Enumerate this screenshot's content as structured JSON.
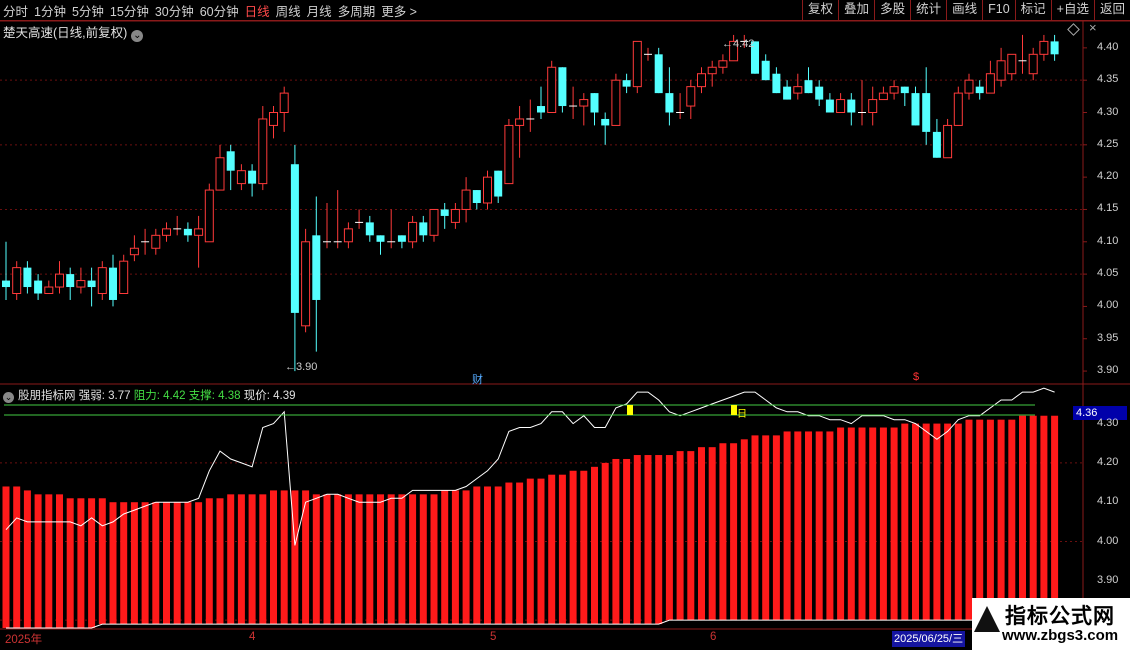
{
  "toolbar": {
    "periods": [
      {
        "label": "分时",
        "active": false
      },
      {
        "label": "1分钟",
        "active": false
      },
      {
        "label": "5分钟",
        "active": false
      },
      {
        "label": "15分钟",
        "active": false
      },
      {
        "label": "30分钟",
        "active": false
      },
      {
        "label": "60分钟",
        "active": false
      },
      {
        "label": "日线",
        "active": true
      },
      {
        "label": "周线",
        "active": false
      },
      {
        "label": "月线",
        "active": false
      },
      {
        "label": "多周期",
        "active": false
      },
      {
        "label": "更多 >",
        "active": false
      }
    ],
    "right_buttons": [
      "复权",
      "叠加",
      "多股",
      "统计",
      "画线",
      "F10",
      "标记",
      "+自选",
      "返回"
    ]
  },
  "main_panel": {
    "title": "楚天高速(日线,前复权)",
    "high_label": "4.42",
    "low_label": "3.90",
    "event_cai": "财",
    "event_s": "$",
    "price_axis": [
      "4.40",
      "4.35",
      "4.30",
      "4.25",
      "4.20",
      "4.15",
      "4.10",
      "4.05",
      "4.00",
      "3.95",
      "3.90"
    ]
  },
  "indicator_panel": {
    "name": "股朋指标网",
    "strength_label": "强弱:",
    "strength_value": "3.77",
    "resistance_label": "阻力:",
    "resistance_value": "4.42",
    "support_label": "支撑:",
    "support_value": "4.38",
    "price_label": "现价:",
    "price_value": "4.39",
    "current_value_box": "4.36",
    "axis": [
      "4.30",
      "4.20",
      "4.10",
      "4.00",
      "3.90",
      "3.80"
    ],
    "mark_sell": "卖",
    "mark_day": "日"
  },
  "date_axis": {
    "labels": [
      "2025年",
      "4",
      "5",
      "6"
    ],
    "cursor_date": "2025/06/25/三"
  },
  "watermark": {
    "line1": "指标公式网",
    "line2": "www.zbgs3.com"
  },
  "colors": {
    "up": "#ff3a3a",
    "down": "#54ffff",
    "grid": "#6a0f0f",
    "line": "#ffffff",
    "level_line": "#44cc44",
    "marker": "#ffff00"
  },
  "chart_data": {
    "type": "candlestick",
    "ylim": [
      3.88,
      4.44
    ],
    "candles": [
      [
        4.04,
        4.03,
        4.1,
        4.01
      ],
      [
        4.02,
        4.06,
        4.07,
        4.01
      ],
      [
        4.06,
        4.03,
        4.07,
        4.02
      ],
      [
        4.04,
        4.02,
        4.05,
        4.01
      ],
      [
        4.02,
        4.03,
        4.04,
        4.02
      ],
      [
        4.03,
        4.05,
        4.07,
        4.02
      ],
      [
        4.05,
        4.03,
        4.06,
        4.01
      ],
      [
        4.03,
        4.04,
        4.06,
        4.02
      ],
      [
        4.04,
        4.03,
        4.06,
        4.0
      ],
      [
        4.02,
        4.06,
        4.07,
        4.01
      ],
      [
        4.06,
        4.01,
        4.08,
        4.0
      ],
      [
        4.02,
        4.07,
        4.08,
        4.02
      ],
      [
        4.08,
        4.09,
        4.11,
        4.07
      ],
      [
        4.1,
        4.1,
        4.12,
        4.08
      ],
      [
        4.09,
        4.11,
        4.12,
        4.08
      ],
      [
        4.11,
        4.12,
        4.13,
        4.1
      ],
      [
        4.12,
        4.12,
        4.14,
        4.11
      ],
      [
        4.12,
        4.11,
        4.13,
        4.1
      ],
      [
        4.11,
        4.12,
        4.14,
        4.06
      ],
      [
        4.1,
        4.18,
        4.19,
        4.1
      ],
      [
        4.18,
        4.23,
        4.25,
        4.18
      ],
      [
        4.24,
        4.21,
        4.25,
        4.18
      ],
      [
        4.19,
        4.21,
        4.22,
        4.18
      ],
      [
        4.21,
        4.19,
        4.22,
        4.17
      ],
      [
        4.19,
        4.29,
        4.31,
        4.18
      ],
      [
        4.28,
        4.3,
        4.31,
        4.26
      ],
      [
        4.3,
        4.33,
        4.34,
        4.27
      ],
      [
        4.22,
        3.99,
        4.25,
        3.9
      ],
      [
        3.97,
        4.1,
        4.12,
        3.96
      ],
      [
        4.11,
        4.01,
        4.17,
        3.93
      ],
      [
        4.1,
        4.1,
        4.16,
        4.09
      ],
      [
        4.1,
        4.1,
        4.18,
        4.09
      ],
      [
        4.1,
        4.12,
        4.13,
        4.09
      ],
      [
        4.13,
        4.13,
        4.15,
        4.12
      ],
      [
        4.13,
        4.11,
        4.14,
        4.1
      ],
      [
        4.11,
        4.1,
        4.11,
        4.08
      ],
      [
        4.1,
        4.1,
        4.15,
        4.09
      ],
      [
        4.11,
        4.1,
        4.11,
        4.09
      ],
      [
        4.1,
        4.13,
        4.14,
        4.09
      ],
      [
        4.13,
        4.11,
        4.14,
        4.1
      ],
      [
        4.11,
        4.15,
        4.15,
        4.1
      ],
      [
        4.15,
        4.14,
        4.16,
        4.12
      ],
      [
        4.13,
        4.15,
        4.16,
        4.12
      ],
      [
        4.15,
        4.18,
        4.2,
        4.13
      ],
      [
        4.18,
        4.16,
        4.18,
        4.15
      ],
      [
        4.16,
        4.2,
        4.21,
        4.15
      ],
      [
        4.21,
        4.17,
        4.21,
        4.16
      ],
      [
        4.19,
        4.28,
        4.29,
        4.19
      ],
      [
        4.28,
        4.29,
        4.31,
        4.23
      ],
      [
        4.29,
        4.29,
        4.32,
        4.27
      ],
      [
        4.31,
        4.3,
        4.34,
        4.29
      ],
      [
        4.3,
        4.37,
        4.38,
        4.3
      ],
      [
        4.37,
        4.31,
        4.37,
        4.3
      ],
      [
        4.31,
        4.31,
        4.34,
        4.29
      ],
      [
        4.31,
        4.32,
        4.33,
        4.28
      ],
      [
        4.33,
        4.3,
        4.33,
        4.28
      ],
      [
        4.29,
        4.28,
        4.3,
        4.25
      ],
      [
        4.28,
        4.35,
        4.36,
        4.28
      ],
      [
        4.35,
        4.34,
        4.36,
        4.33
      ],
      [
        4.34,
        4.41,
        4.41,
        4.33
      ],
      [
        4.39,
        4.39,
        4.4,
        4.38
      ],
      [
        4.39,
        4.33,
        4.4,
        4.33
      ],
      [
        4.33,
        4.3,
        4.37,
        4.28
      ],
      [
        4.3,
        4.3,
        4.33,
        4.29
      ],
      [
        4.31,
        4.34,
        4.35,
        4.29
      ],
      [
        4.34,
        4.36,
        4.37,
        4.33
      ],
      [
        4.36,
        4.37,
        4.38,
        4.34
      ],
      [
        4.37,
        4.38,
        4.39,
        4.36
      ],
      [
        4.38,
        4.41,
        4.42,
        4.38
      ],
      [
        4.41,
        4.41,
        4.42,
        4.4
      ],
      [
        4.41,
        4.36,
        4.41,
        4.36
      ],
      [
        4.38,
        4.35,
        4.39,
        4.35
      ],
      [
        4.36,
        4.33,
        4.37,
        4.33
      ],
      [
        4.34,
        4.32,
        4.35,
        4.32
      ],
      [
        4.33,
        4.34,
        4.36,
        4.32
      ],
      [
        4.35,
        4.33,
        4.37,
        4.33
      ],
      [
        4.34,
        4.32,
        4.35,
        4.31
      ],
      [
        4.32,
        4.3,
        4.33,
        4.3
      ],
      [
        4.3,
        4.32,
        4.33,
        4.3
      ],
      [
        4.32,
        4.3,
        4.33,
        4.28
      ],
      [
        4.3,
        4.3,
        4.35,
        4.28
      ],
      [
        4.3,
        4.32,
        4.34,
        4.28
      ],
      [
        4.32,
        4.33,
        4.34,
        4.32
      ],
      [
        4.33,
        4.34,
        4.35,
        4.32
      ],
      [
        4.34,
        4.33,
        4.34,
        4.31
      ],
      [
        4.33,
        4.28,
        4.34,
        4.28
      ],
      [
        4.33,
        4.27,
        4.37,
        4.25
      ],
      [
        4.27,
        4.23,
        4.29,
        4.23
      ],
      [
        4.23,
        4.28,
        4.29,
        4.23
      ],
      [
        4.28,
        4.33,
        4.34,
        4.28
      ],
      [
        4.33,
        4.35,
        4.36,
        4.32
      ],
      [
        4.34,
        4.33,
        4.35,
        4.32
      ],
      [
        4.33,
        4.36,
        4.38,
        4.33
      ],
      [
        4.35,
        4.38,
        4.4,
        4.34
      ],
      [
        4.36,
        4.39,
        4.39,
        4.35
      ],
      [
        4.38,
        4.38,
        4.42,
        4.36
      ],
      [
        4.36,
        4.39,
        4.4,
        4.35
      ],
      [
        4.39,
        4.41,
        4.42,
        4.38
      ],
      [
        4.41,
        4.39,
        4.42,
        4.38
      ]
    ],
    "indicator_axis": [
      3.78,
      4.36
    ],
    "bar_top": [
      4.14,
      4.14,
      4.13,
      4.12,
      4.12,
      4.12,
      4.11,
      4.11,
      4.11,
      4.11,
      4.1,
      4.1,
      4.1,
      4.1,
      4.1,
      4.1,
      4.1,
      4.1,
      4.1,
      4.11,
      4.11,
      4.12,
      4.12,
      4.12,
      4.12,
      4.13,
      4.13,
      4.13,
      4.13,
      4.12,
      4.12,
      4.12,
      4.12,
      4.12,
      4.12,
      4.12,
      4.12,
      4.12,
      4.12,
      4.12,
      4.12,
      4.13,
      4.13,
      4.13,
      4.14,
      4.14,
      4.14,
      4.15,
      4.15,
      4.16,
      4.16,
      4.17,
      4.17,
      4.18,
      4.18,
      4.19,
      4.2,
      4.21,
      4.21,
      4.22,
      4.22,
      4.22,
      4.22,
      4.23,
      4.23,
      4.24,
      4.24,
      4.25,
      4.25,
      4.26,
      4.27,
      4.27,
      4.27,
      4.28,
      4.28,
      4.28,
      4.28,
      4.28,
      4.29,
      4.29,
      4.29,
      4.29,
      4.29,
      4.29,
      4.3,
      4.3,
      4.3,
      4.3,
      4.3,
      4.3,
      4.31,
      4.31,
      4.31,
      4.31,
      4.31,
      4.32,
      4.32,
      4.32,
      4.32
    ],
    "strength_line": [
      4.03,
      4.06,
      4.05,
      4.05,
      4.05,
      4.05,
      4.05,
      4.04,
      4.06,
      4.04,
      4.05,
      4.07,
      4.08,
      4.09,
      4.1,
      4.1,
      4.1,
      4.1,
      4.11,
      4.18,
      4.23,
      4.21,
      4.2,
      4.19,
      4.29,
      4.3,
      4.33,
      3.99,
      4.1,
      4.11,
      4.12,
      4.12,
      4.11,
      4.1,
      4.1,
      4.1,
      4.11,
      4.11,
      4.13,
      4.13,
      4.13,
      4.13,
      4.13,
      4.14,
      4.16,
      4.18,
      4.21,
      4.28,
      4.29,
      4.29,
      4.3,
      4.33,
      4.33,
      4.3,
      4.32,
      4.29,
      4.29,
      4.34,
      4.35,
      4.38,
      4.38,
      4.36,
      4.33,
      4.32,
      4.33,
      4.34,
      4.35,
      4.36,
      4.37,
      4.38,
      4.38,
      4.36,
      4.34,
      4.33,
      4.33,
      4.32,
      4.32,
      4.31,
      4.31,
      4.3,
      4.32,
      4.32,
      4.32,
      4.31,
      4.31,
      4.3,
      4.28,
      4.26,
      4.28,
      4.31,
      4.32,
      4.32,
      4.34,
      4.36,
      4.36,
      4.38,
      4.38,
      4.39,
      4.38
    ],
    "bar_bottom_line": [
      3.78,
      3.78,
      3.78,
      3.78,
      3.78,
      3.78,
      3.78,
      3.78,
      3.78,
      3.79,
      3.79,
      3.79,
      3.79,
      3.79,
      3.79,
      3.79,
      3.79,
      3.79,
      3.79,
      3.79,
      3.79,
      3.79,
      3.79,
      3.79,
      3.79,
      3.79,
      3.79,
      3.79,
      3.79,
      3.79,
      3.79,
      3.79,
      3.79,
      3.79,
      3.79,
      3.79,
      3.79,
      3.79,
      3.79,
      3.79,
      3.79,
      3.79,
      3.79,
      3.79,
      3.79,
      3.79,
      3.79,
      3.79,
      3.79,
      3.79,
      3.79,
      3.79,
      3.79,
      3.79,
      3.79,
      3.79,
      3.79,
      3.79,
      3.79,
      3.79,
      3.79,
      3.79,
      3.8,
      3.8,
      3.8,
      3.8,
      3.8,
      3.8,
      3.8,
      3.8,
      3.8,
      3.8,
      3.8,
      3.8,
      3.8,
      3.8,
      3.8,
      3.8,
      3.8,
      3.8,
      3.8,
      3.8,
      3.8,
      3.8,
      3.8,
      3.8,
      3.8,
      3.8,
      3.8,
      3.8,
      3.8,
      3.8,
      3.8,
      3.8,
      3.8,
      3.8,
      3.8,
      3.8,
      3.8
    ],
    "resistance": 4.42,
    "support": 4.38
  }
}
